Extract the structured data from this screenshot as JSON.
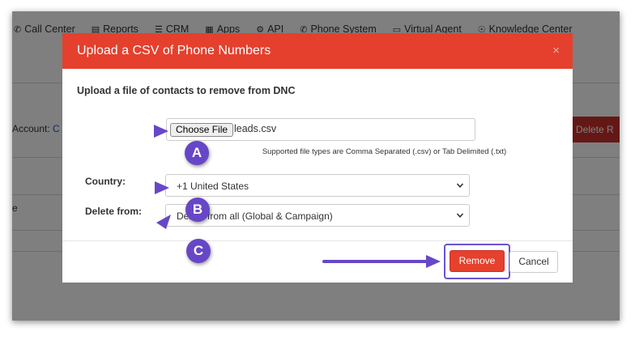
{
  "nav": {
    "items": [
      {
        "label": "Call Center",
        "icon": "phone-icon"
      },
      {
        "label": "Reports",
        "icon": "bar-chart-icon"
      },
      {
        "label": "CRM",
        "icon": "list-icon"
      },
      {
        "label": "Apps",
        "icon": "grid-icon"
      },
      {
        "label": "API",
        "icon": "gear-icon"
      },
      {
        "label": "Phone System",
        "icon": "phone-icon"
      },
      {
        "label": "Virtual Agent",
        "icon": "monitor-icon"
      },
      {
        "label": "Knowledge Center",
        "icon": "lightbulb-icon"
      }
    ]
  },
  "background": {
    "account_label": "Account:",
    "account_value": "C",
    "delete_button_label": "Delete R",
    "row_text": "e"
  },
  "modal": {
    "title": "Upload a CSV of Phone Numbers",
    "close_label": "×",
    "subtitle": "Upload a file of contacts to remove from DNC",
    "file": {
      "choose_label": "Choose File",
      "file_name": "leads.csv",
      "help_text": "Supported file types are Comma Separated (.csv) or Tab Delimited (.txt)"
    },
    "country": {
      "label": "Country:",
      "selected": "+1 United States"
    },
    "delete_from": {
      "label": "Delete from:",
      "selected": "Delete from all (Global & Campaign)"
    },
    "buttons": {
      "remove_label": "Remove",
      "cancel_label": "Cancel"
    }
  },
  "annotations": {
    "badges": [
      "A",
      "B",
      "C"
    ],
    "badge_color": "#6747c7",
    "highlight_color": "#6b53cf"
  },
  "colors": {
    "modal_header": "#e5402d",
    "remove_button": "#e5412d",
    "overlay": "rgba(0,0,0,0.5)"
  }
}
